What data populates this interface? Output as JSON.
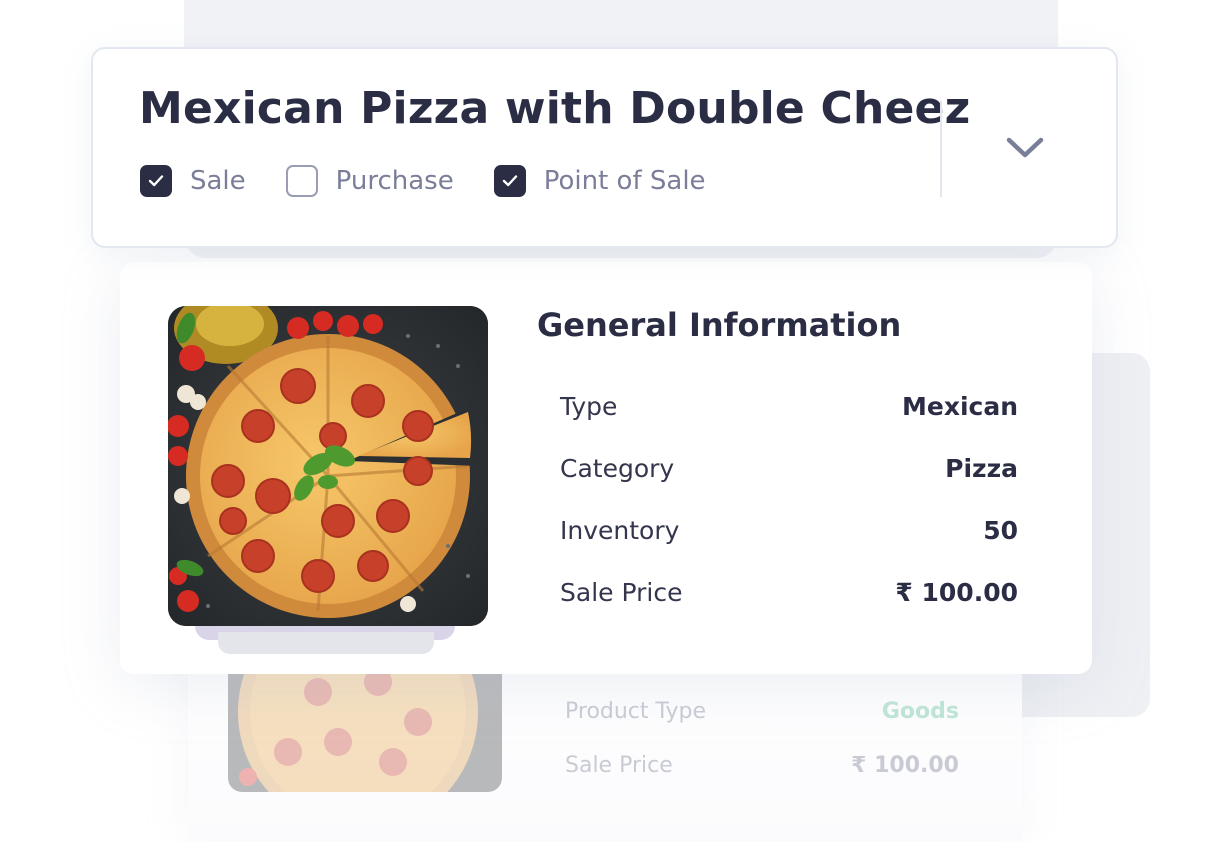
{
  "product": {
    "title": "Mexican Pizza with Double Cheez",
    "flags": [
      {
        "label": "Sale",
        "checked": true
      },
      {
        "label": "Purchase",
        "checked": false
      },
      {
        "label": "Point of Sale",
        "checked": true
      }
    ]
  },
  "general_info": {
    "heading": "General Information",
    "rows": [
      {
        "label": "Type",
        "value": "Mexican"
      },
      {
        "label": "Category",
        "value": "Pizza"
      },
      {
        "label": "Inventory",
        "value": "50"
      },
      {
        "label": "Sale Price",
        "value": "₹ 100.00"
      }
    ]
  },
  "background_card": {
    "rows": [
      {
        "label": "Product Type",
        "value": "Goods"
      },
      {
        "label": "Sale Price",
        "value": "₹ 100.00"
      }
    ]
  },
  "icons": {
    "expand": "chevron-down-icon",
    "checkbox": "checkmark-icon"
  },
  "colors": {
    "primary_text": "#2b2d45",
    "muted_text": "#7a7e99",
    "goods_green": "#bfe6d7"
  }
}
